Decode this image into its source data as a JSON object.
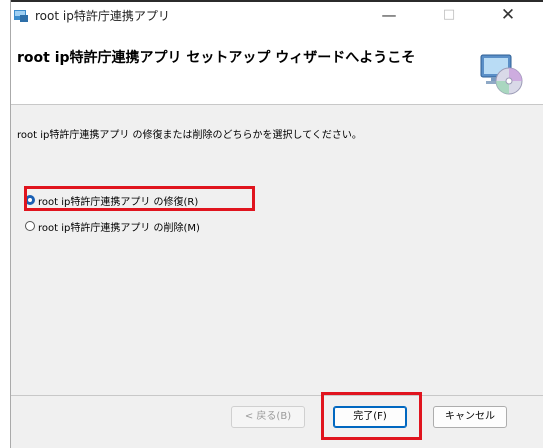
{
  "window": {
    "title": "root ip特許庁連携アプリ",
    "controls": {
      "minimize": "—",
      "maximize": "□",
      "close": "✕"
    }
  },
  "header": {
    "title": "root ip特許庁連携アプリ セットアップ ウィザードへようこそ",
    "icon": "installer-disc-icon"
  },
  "main": {
    "description": "root ip特許庁連携アプリ の修復または削除のどちらかを選択してください。",
    "options": [
      {
        "label": "root ip特許庁連携アプリ の修復(R)",
        "selected": true
      },
      {
        "label": "root ip特許庁連携アプリ の削除(M)",
        "selected": false
      }
    ]
  },
  "footer": {
    "back_label": "< 戻る(B)",
    "finish_label": "完了(F)",
    "cancel_label": "キャンセル"
  },
  "colors": {
    "highlight": "#e0141e",
    "accent": "#0067c0",
    "radio_selected": "#1a5fb4"
  }
}
